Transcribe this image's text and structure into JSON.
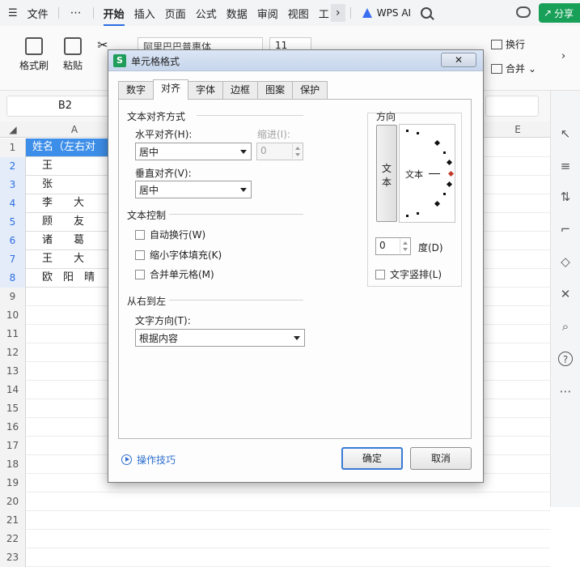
{
  "menubar": {
    "hamburger": "☰",
    "file": "文件",
    "more": "⋯",
    "tabs": [
      "开始",
      "插入",
      "页面",
      "公式",
      "数据",
      "审阅",
      "视图",
      "工"
    ],
    "active_tab": "开始",
    "wps_ai": "WPS AI",
    "share": "分享"
  },
  "ribbon": {
    "format_painter": "格式刷",
    "paste": "粘贴",
    "font_name": "阿里巴巴普惠体",
    "font_size": "11",
    "wrap_text": "换行",
    "merge": "合并"
  },
  "namebox": "B2",
  "sheet": {
    "columns": [
      "A",
      "E"
    ],
    "rows": [
      "1",
      "2",
      "3",
      "4",
      "5",
      "6",
      "7",
      "8",
      "9",
      "10",
      "11",
      "12",
      "13",
      "14",
      "15",
      "16",
      "17",
      "18",
      "19",
      "20",
      "21",
      "22",
      "23"
    ],
    "cells": [
      "姓名（左右对",
      "王",
      "张",
      "李　　大",
      "顾　　友",
      "诸　　葛",
      "王　　大",
      "欧　阳　晴"
    ]
  },
  "dialog": {
    "title": "单元格格式",
    "close": "✕",
    "tabs": [
      "数字",
      "对齐",
      "字体",
      "边框",
      "图案",
      "保护"
    ],
    "active_tab": "对齐",
    "text_alignment": {
      "section": "文本对齐方式",
      "horizontal_label": "水平对齐(H):",
      "horizontal_value": "居中",
      "indent_label": "缩进(I):",
      "indent_value": "0",
      "vertical_label": "垂直对齐(V):",
      "vertical_value": "居中"
    },
    "text_control": {
      "section": "文本控制",
      "wrap": "自动换行(W)",
      "shrink": "缩小字体填充(K)",
      "merge": "合并单元格(M)"
    },
    "rtl": {
      "section": "从右到左",
      "direction_label": "文字方向(T):",
      "direction_value": "根据内容"
    },
    "orientation": {
      "section": "方向",
      "vertical_chars": [
        "文",
        "本"
      ],
      "dial_text": "文本",
      "degree_value": "0",
      "degree_label": "度(D)",
      "vertical_stack": "文字竖排(L)"
    },
    "help": "操作技巧",
    "ok": "确定",
    "cancel": "取消"
  }
}
